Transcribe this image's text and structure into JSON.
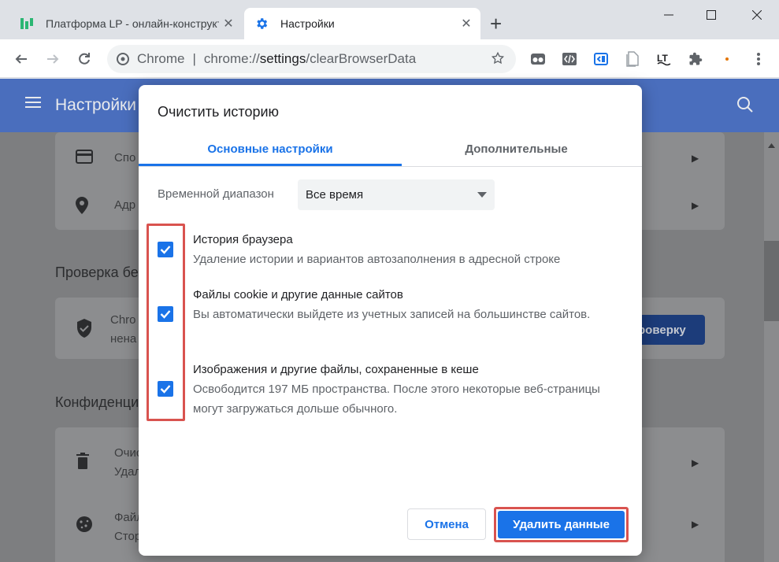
{
  "browser": {
    "tabs": [
      {
        "title": "Платформа LP - онлайн-конструктор",
        "close": "✕",
        "active": false
      },
      {
        "title": "Настройки",
        "close": "✕",
        "active": true
      }
    ],
    "new_tab": "+",
    "omnibox": {
      "chip": "Chrome",
      "separator": "|",
      "url_prefix": "chrome://",
      "url_host": "settings",
      "url_path": "/clearBrowserData"
    },
    "extensions": [
      "tab-grid-icon",
      "code-icon",
      "inspector-icon",
      "document-icon",
      "lt-icon",
      "puzzle-icon",
      "dot-icon"
    ]
  },
  "settings_page": {
    "header_title": "Настройки",
    "rows_top": [
      {
        "label": "Спо",
        "icon": "card-icon"
      },
      {
        "label": "Адр",
        "icon": "location-icon"
      }
    ],
    "section_safety": "Проверка бе",
    "safety_row": {
      "line1": "Chro",
      "line2": "нена",
      "button": "роверку"
    },
    "section_privacy": "Конфиденци",
    "rows_privacy": [
      {
        "label": "Очис",
        "sub": "Удал",
        "icon": "trash-icon"
      },
      {
        "label": "Файл",
        "sub": "Стор",
        "icon": "cookie-icon"
      }
    ]
  },
  "dialog": {
    "title": "Очистить историю",
    "tabs": {
      "basic": "Основные настройки",
      "advanced": "Дополнительные"
    },
    "time_range_label": "Временной диапазон",
    "time_range_value": "Все время",
    "items": [
      {
        "title": "История браузера",
        "desc": "Удаление истории и вариантов автозаполнения в адресной строке",
        "checked": true
      },
      {
        "title": "Файлы cookie и другие данные сайтов",
        "desc": "Вы автоматически выйдете из учетных записей на большинстве сайтов.",
        "checked": true
      },
      {
        "title": "Изображения и другие файлы, сохраненные в кеше",
        "desc": "Освободится 197 МБ пространства. После этого некоторые веб-страницы могут загружаться дольше обычного.",
        "checked": true
      }
    ],
    "cancel_label": "Отмена",
    "delete_label": "Удалить данные"
  },
  "colors": {
    "accent": "#1a73e8",
    "highlight": "#d9534f",
    "header_blue": "#4a6ebd"
  }
}
